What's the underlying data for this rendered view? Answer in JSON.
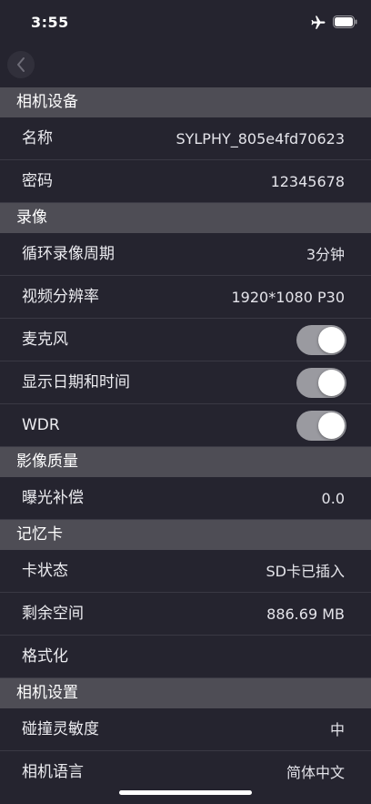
{
  "status": {
    "time": "3:55"
  },
  "sections": {
    "camera_device": {
      "title": "相机设备",
      "name_label": "名称",
      "name_value": "SYLPHY_805e4fd70623",
      "password_label": "密码",
      "password_value": "12345678"
    },
    "recording": {
      "title": "录像",
      "loop_label": "循环录像周期",
      "loop_value": "3分钟",
      "resolution_label": "视频分辨率",
      "resolution_value": "1920*1080 P30",
      "mic_label": "麦克风",
      "mic_on": true,
      "datetime_label": "显示日期和时间",
      "datetime_on": true,
      "wdr_label": "WDR",
      "wdr_on": true
    },
    "image_quality": {
      "title": "影像质量",
      "exposure_label": "曝光补偿",
      "exposure_value": "0.0"
    },
    "memory_card": {
      "title": "记忆卡",
      "card_status_label": "卡状态",
      "card_status_value": "SD卡已插入",
      "free_space_label": "剩余空间",
      "free_space_value": "886.69 MB",
      "format_label": "格式化"
    },
    "camera_settings": {
      "title": "相机设置",
      "collision_label": "碰撞灵敏度",
      "collision_value": "中",
      "language_label": "相机语言",
      "language_value": "简体中文"
    }
  },
  "icons": {
    "airplane": "airplane-icon",
    "battery": "battery-icon",
    "back": "chevron-left-icon"
  },
  "colors": {
    "background": "#25242f",
    "section_header": "#4e4d55",
    "toggle_track": "#9a9aa0",
    "toggle_knob": "#ffffff"
  }
}
